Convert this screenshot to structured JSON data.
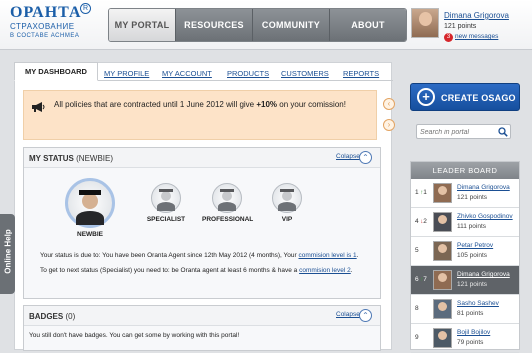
{
  "brand": {
    "name": "ОРАНТА",
    "line1": "СТРАХОВАНИЕ",
    "line2": "В СОСТАВЕ АСНМЕА"
  },
  "nav": [
    {
      "label": "MY PORTAL",
      "active": true
    },
    {
      "label": "RESOURCES",
      "active": false
    },
    {
      "label": "COMMUNITY",
      "active": false
    },
    {
      "label": "ABOUT",
      "active": false
    }
  ],
  "user": {
    "name": "Dimana Grigorova",
    "points": "121 points",
    "message_count": "3",
    "messages_label": "new messages"
  },
  "subtabs": [
    "MY DASHBOARD",
    "MY PROFILE",
    "MY ACCOUNT",
    "PRODUCTS",
    "CUSTOMERS",
    "REPORTS"
  ],
  "notice": {
    "text_before": "All policies that are contracted until 1 June 2012 will give ",
    "highlight": "+10%",
    "text_after": " on your comission!"
  },
  "status_panel": {
    "title": "MY STATUS",
    "level": "(NEWBIE)",
    "collapse": "Colapse",
    "levels": [
      "NEWBIE",
      "SPECIALIST",
      "PROFESSIONAL",
      "VIP"
    ],
    "line1_text": "Your status is due to: You have been Oranta Agent since 12th May 2012 (4 months), Your ",
    "line1_link": "commision level is 1",
    "line1_end": ".",
    "line2_text": "To get to next status (Specialist) you need to: be Oranta agent at least 6 months & have a ",
    "line2_link": "commision level 2",
    "line2_end": "."
  },
  "badges_panel": {
    "title": "BADGES",
    "count": "(0)",
    "collapse": "Colapse",
    "text": "You still don't have badges. You can get some by working with this portal!"
  },
  "online_help": "Online Help",
  "create_button": "CREATE OSAGO",
  "search": {
    "placeholder": "Search in portal"
  },
  "leaderboard": {
    "title": "LEADER BOARD",
    "rows": [
      {
        "rank": "1",
        "change": "1",
        "direction": "up",
        "name": "Dimana Grigorova",
        "points": "121 points",
        "highlight": false
      },
      {
        "rank": "4",
        "change": "2",
        "direction": "down",
        "name": "Zhivko Gospodinov",
        "points": "111 points",
        "highlight": false
      },
      {
        "rank": "5",
        "change": "",
        "direction": "none",
        "name": "Petar Petrov",
        "points": "105 points",
        "highlight": false
      },
      {
        "rank": "6",
        "change": "7",
        "direction": "up",
        "name": "Dimana Grigorova",
        "points": "121 points",
        "highlight": true
      },
      {
        "rank": "8",
        "change": "",
        "direction": "none",
        "name": "Sasho Sashev",
        "points": "81 points",
        "highlight": false
      },
      {
        "rank": "9",
        "change": "",
        "direction": "none",
        "name": "Bojil Bojilov",
        "points": "79 points",
        "highlight": false
      }
    ]
  },
  "colors": {
    "brand_blue": "#1b5ea8",
    "link_blue": "#1b4f93",
    "notice_bg": "#fde3c8",
    "nav_gray": "#7a7f84",
    "up_green": "#3a9b3a",
    "down_red": "#cc2b2b"
  },
  "icons": {
    "megaphone": "megaphone-icon",
    "search": "search-icon",
    "collapse": "chevron-up-icon",
    "create": "plus-icon",
    "help": "help-icon"
  }
}
